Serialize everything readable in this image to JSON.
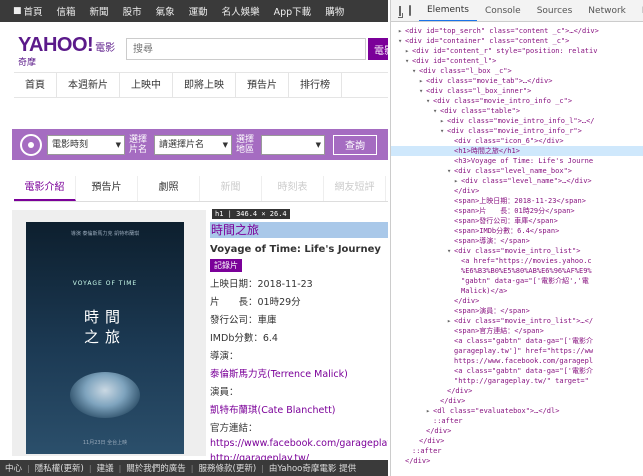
{
  "page": {
    "topnav": [
      {
        "label": "首頁",
        "icon": "home-icon"
      },
      {
        "label": "信箱"
      },
      {
        "label": "新聞"
      },
      {
        "label": "股市"
      },
      {
        "label": "氣象"
      },
      {
        "label": "運動"
      },
      {
        "label": "名人娛樂"
      },
      {
        "label": "App下載"
      },
      {
        "label": "購物"
      }
    ],
    "logo": {
      "brand": "YAHOO!",
      "sub": "電影",
      "tagline": "奇摩"
    },
    "search": {
      "placeholder": "搜尋",
      "button": "電影"
    },
    "mainnav": [
      "首頁",
      "本週新片",
      "上映中",
      "即將上映",
      "預告片",
      "排行榜"
    ],
    "filter": {
      "theater_select": "電影時刻",
      "label_movie": "選擇片名",
      "movie_select": "請選擇片名",
      "label_area": "選擇地區",
      "area_select": "",
      "query_button": "查詢"
    },
    "tabs": [
      "電影介紹",
      "預告片",
      "劇照",
      "新聞",
      "時刻表",
      "網友短評"
    ],
    "poster": {
      "top_text": "導演 泰倫斯馬力克   凱特布蘭琪",
      "title_en": "VOYAGE OF TIME",
      "title_line1": "時間",
      "title_line2": "之旅",
      "bottom_text": "11月23日 全台上映"
    },
    "dim_badge": "h1 | 346.4 × 26.4",
    "movie": {
      "title": "時間之旅",
      "title_en": "Voyage of Time: Life's Journey",
      "level": "記錄片",
      "release_date": "上映日期：2018-11-23",
      "runtime": "片　　長：01時29分",
      "distributor": "發行公司：車庫",
      "imdb": "IMDb分數：6.4",
      "director_label": "導演：",
      "director": "泰倫斯馬力克(Terrence Malick)",
      "cast_label": "演員：",
      "cast": "凱特布蘭琪(Cate Blanchett)",
      "site_label": "官方連結：",
      "site1": "https://www.facebook.com/garageplay.tw",
      "site2": "http://garageplay.tw/"
    },
    "footer": [
      "中心",
      "隱私權(更新)",
      "建議",
      "關於我們的廣告",
      "服務條款(更新)",
      "由Yahoo奇摩電影 提供"
    ]
  },
  "devtools": {
    "tabs": [
      "Elements",
      "Console",
      "Sources",
      "Network",
      "Perfo"
    ],
    "active_tab": "Elements",
    "dom_lines": [
      {
        "indent": 3,
        "tri": "▶",
        "text": "<div id=\"top_serch\" class=\"content _c\">…</div>"
      },
      {
        "indent": 3,
        "tri": "▼",
        "text": "<div id=\"container\" class=\"content _c\">"
      },
      {
        "indent": 4,
        "tri": "▶",
        "text": "<div id=\"content_r\" style=\"position: relativ"
      },
      {
        "indent": 4,
        "tri": "▼",
        "text": "<div id=\"content_l\">"
      },
      {
        "indent": 5,
        "tri": "▼",
        "text": "<div class=\"l_box _c\">"
      },
      {
        "indent": 6,
        "tri": "▶",
        "text": "<div class=\"movie_tab\">…</div>"
      },
      {
        "indent": 6,
        "tri": "▼",
        "text": "<div class=\"l_box_inner\">"
      },
      {
        "indent": 7,
        "tri": "▼",
        "text": "<div class=\"movie_intro_info _c\">"
      },
      {
        "indent": 8,
        "tri": "▼",
        "text": "<div class=\"table\">"
      },
      {
        "indent": 9,
        "tri": "▶",
        "text": "<div class=\"movie_intro_info_l\">…</"
      },
      {
        "indent": 9,
        "tri": "▼",
        "text": "<div class=\"movie_intro_info_r\">"
      },
      {
        "indent": 10,
        "tri": "",
        "text": "<div class=\"icon_6\"></div>"
      },
      {
        "indent": 10,
        "tri": "",
        "text": "<h1>時間之旅</h1>",
        "selected": true
      },
      {
        "indent": 10,
        "tri": "",
        "text": "<h3>Voyage of Time: Life's Journe"
      },
      {
        "indent": 10,
        "tri": "▼",
        "text": "<div class=\"level_name_box\">"
      },
      {
        "indent": 11,
        "tri": "▶",
        "text": "<div class=\"level_name\">…</div>"
      },
      {
        "indent": 10,
        "tri": "",
        "text": "</div>"
      },
      {
        "indent": 10,
        "tri": "",
        "text": "<span>上映日期：2018-11-23</span>"
      },
      {
        "indent": 10,
        "tri": "",
        "text": "<span>片　　長：01時29分</span>"
      },
      {
        "indent": 10,
        "tri": "",
        "text": "<span>發行公司：車庫</span>"
      },
      {
        "indent": 10,
        "tri": "",
        "text": "<span>IMDb分數：6.4</span>"
      },
      {
        "indent": 10,
        "tri": "",
        "text": "<span>導演：</span>"
      },
      {
        "indent": 10,
        "tri": "▼",
        "text": "<div class=\"movie_intro_list\">"
      },
      {
        "indent": 11,
        "tri": "",
        "text": "<a href=\"https://movies.yahoo.c"
      },
      {
        "indent": 11,
        "tri": "",
        "text": "%E6%B3%B0%E5%80%AB%E6%96%AF%E9%"
      },
      {
        "indent": 11,
        "tri": "",
        "text": "\"gabtn\" data-ga=\"['電影介紹','電"
      },
      {
        "indent": 11,
        "tri": "",
        "text": "Malick)</a>"
      },
      {
        "indent": 10,
        "tri": "",
        "text": "</div>"
      },
      {
        "indent": 10,
        "tri": "",
        "text": "<span>演員：</span>"
      },
      {
        "indent": 10,
        "tri": "▶",
        "text": "<div class=\"movie_intro_list\">…</"
      },
      {
        "indent": 10,
        "tri": "",
        "text": "<span>官方連結：</span>"
      },
      {
        "indent": 10,
        "tri": "",
        "text": "<a class=\"gabtn\" data-ga=\"['電影介"
      },
      {
        "indent": 10,
        "tri": "",
        "text": "garageplay.tw']\" href=\"https://ww"
      },
      {
        "indent": 10,
        "tri": "",
        "text": "https://www.facebook.com/garagepl"
      },
      {
        "indent": 10,
        "tri": "",
        "text": "<a class=\"gabtn\" data-ga=\"['電影介"
      },
      {
        "indent": 10,
        "tri": "",
        "text": "\"http://garageplay.tw/\" target=\""
      },
      {
        "indent": 9,
        "tri": "",
        "text": "</div>"
      },
      {
        "indent": 8,
        "tri": "",
        "text": "</div>"
      },
      {
        "indent": 7,
        "tri": "▶",
        "text": "<dl class=\"evaluatebox\">…</dl>"
      },
      {
        "indent": 7,
        "tri": "",
        "text": "::after"
      },
      {
        "indent": 6,
        "tri": "",
        "text": "</div>"
      },
      {
        "indent": 5,
        "tri": "",
        "text": "</div>"
      },
      {
        "indent": 4,
        "tri": "",
        "text": "::after"
      },
      {
        "indent": 3,
        "tri": "",
        "text": "</div>"
      }
    ]
  }
}
